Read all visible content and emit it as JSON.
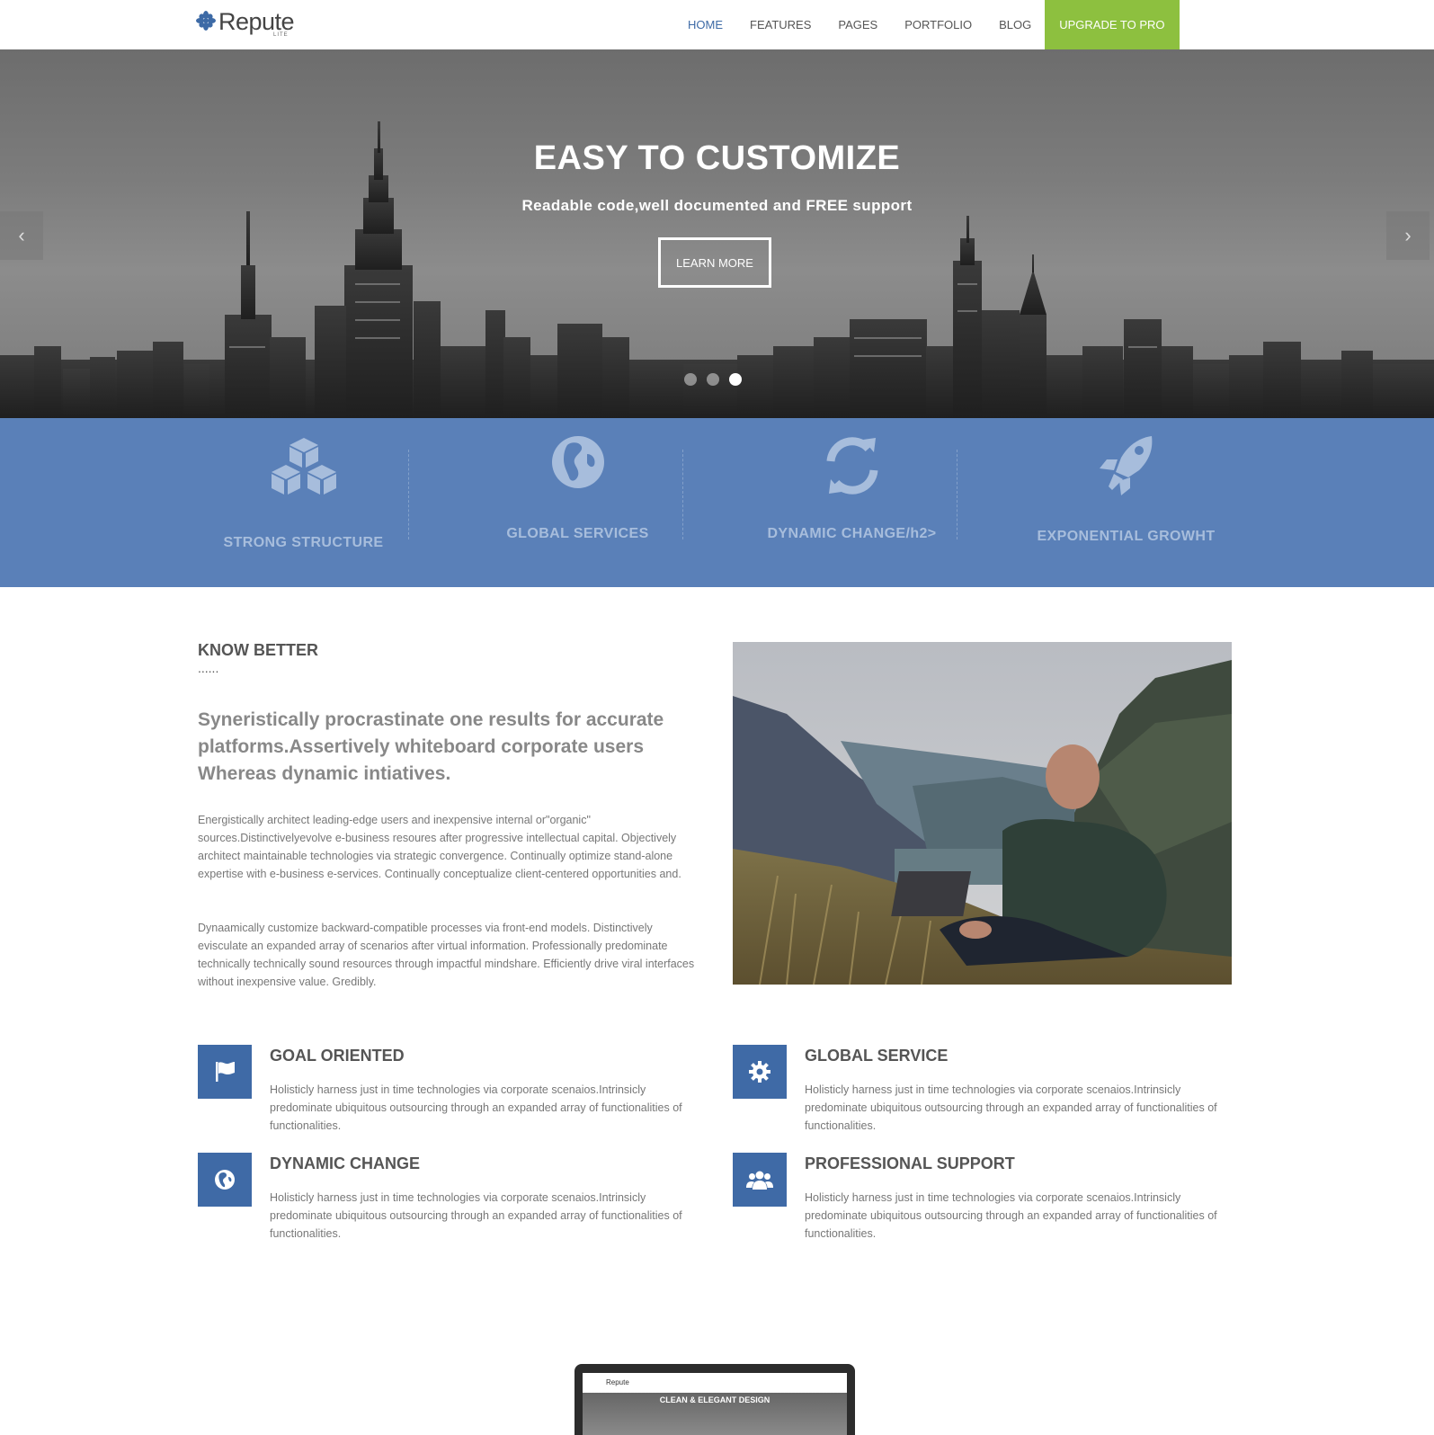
{
  "brand": {
    "name": "Repute",
    "sub": "LITE",
    "star_color": "#3d6aa6"
  },
  "nav": {
    "items": [
      {
        "label": "HOME",
        "active": true
      },
      {
        "label": "FEATURES"
      },
      {
        "label": "PAGES"
      },
      {
        "label": "PORTFOLIO"
      },
      {
        "label": "BLOG"
      }
    ],
    "pro_label": "UPGRADE TO PRO",
    "pro_color": "#8dc03f"
  },
  "hero": {
    "title": "EASY TO CUSTOMIZE",
    "subtitle": "Readable code,well documented and FREE support",
    "button": "LEARN MORE",
    "prev_icon": "chevron-left-icon",
    "next_icon": "chevron-right-icon",
    "slides": 3,
    "active_slide": 3
  },
  "features": {
    "color": "#5a80b8",
    "items": [
      {
        "label": "STRONG STRUCTURE",
        "icon": "cubes-icon"
      },
      {
        "label": "GLOBAL SERVICES",
        "icon": "globe-icon"
      },
      {
        "label": "DYNAMIC CHANGE/h2>",
        "icon": "refresh-icon"
      },
      {
        "label": "EXPONENTIAL GROWHT",
        "icon": "rocket-icon"
      }
    ]
  },
  "know_better": {
    "title": "KNOW BETTER",
    "dots": "......",
    "lead": "Syneristically procrastinate one results for accurate platforms.Assertively whiteboard corporate users Whereas dynamic intiatives.",
    "p1": "Energistically architect leading-edge users and inexpensive internal or\"organic\" sources.Distinctivelyevolve e-business resoures after progressive intellectual capital. Objectively architect maintainable technologies via strategic convergence. Continually optimize stand-alone expertise with e-business e-services. Continually conceptualize client-centered opportunities and.",
    "p2": "Dynaamically customize backward-compatible processes via front-end models. Distinctively evisculate an expanded array of scenarios after virtual information. Professionally predominate technically technically sound resources through impactful mindshare. Efficiently drive viral interfaces without inexpensive value. Gredibly."
  },
  "services": [
    {
      "title": "GOAL ORIENTED",
      "icon": "flag-icon",
      "text": "Holisticly harness just in time technologies via corporate scenaios.Intrinsicly predominate ubiquitous outsourcing through an expanded array of functionalities of functionalities."
    },
    {
      "title": "GLOBAL SERVICE",
      "icon": "gear-icon",
      "text": "Holisticly harness just in time technologies via corporate scenaios.Intrinsicly predominate ubiquitous outsourcing through an expanded array of functionalities of functionalities."
    },
    {
      "title": "DYNAMIC CHANGE",
      "icon": "globe-icon",
      "text": "Holisticly harness just in time technologies via corporate scenaios.Intrinsicly predominate ubiquitous outsourcing through an expanded array of functionalities of functionalities."
    },
    {
      "title": "PROFESSIONAL SUPPORT",
      "icon": "users-icon",
      "text": "Holisticly harness just in time technologies via corporate scenaios.Intrinsicly predominate ubiquitous outsourcing through an expanded array of functionalities of functionalities."
    }
  ],
  "showcase": {
    "screen_logo": "Repute",
    "screen_title": "CLEAN & ELEGANT DESIGN"
  }
}
